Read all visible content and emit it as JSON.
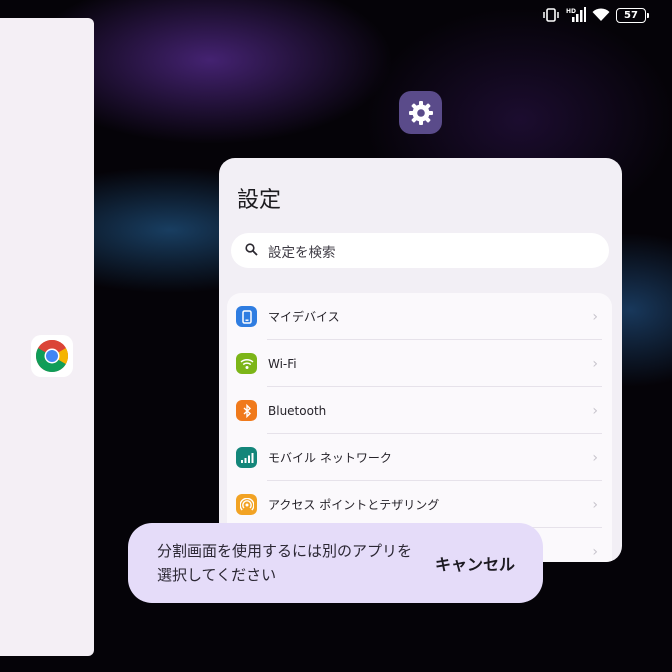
{
  "status_bar": {
    "icons": [
      "vibrate-icon",
      "cellular-signal-icon",
      "wifi-icon",
      "battery-icon"
    ],
    "network_label": "HD",
    "battery_level": "57"
  },
  "recents": {
    "left_app_icon": "chrome-icon",
    "focused_app_icon": "settings-gear-icon"
  },
  "settings": {
    "title": "設定",
    "search_placeholder": "設定を検索",
    "items": [
      {
        "label": "マイデバイス",
        "icon": "phone-icon",
        "color": "#2f7de1"
      },
      {
        "label": "Wi-Fi",
        "icon": "wifi-icon",
        "color": "#7cb518"
      },
      {
        "label": "Bluetooth",
        "icon": "bluetooth-icon",
        "color": "#f07a1c"
      },
      {
        "label": "モバイル ネットワーク",
        "icon": "signal-bars-icon",
        "color": "#14867a"
      },
      {
        "label": "アクセス ポイントとテザリング",
        "icon": "hotspot-icon",
        "color": "#f2a324"
      }
    ]
  },
  "split_screen": {
    "message": "分割画面を使用するには別のアプリを選択してください",
    "cancel_label": "キャンセル"
  },
  "colors": {
    "toast_bg": "#e5dcf9",
    "settings_card_bg": "#f2eff5",
    "settings_icon_bg": "#5a4b8a"
  }
}
